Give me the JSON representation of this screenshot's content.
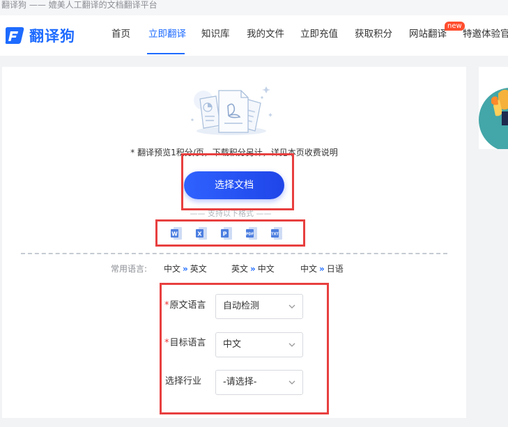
{
  "topbar": {
    "tagline": "翻译狗 —— 媲美人工翻译的文档翻译平台"
  },
  "brand": {
    "name": "翻译狗",
    "accent": "#1e6bff"
  },
  "nav": {
    "items": [
      {
        "label": "首页"
      },
      {
        "label": "立即翻译",
        "active": true
      },
      {
        "label": "知识库"
      },
      {
        "label": "我的文件"
      },
      {
        "label": "立即充值"
      },
      {
        "label": "获取积分"
      },
      {
        "label": "网站翻译"
      },
      {
        "label": "特邀体验官"
      }
    ],
    "badge": "new"
  },
  "upload": {
    "fee_note": "* 翻译预览1积分/页，下载积分另计，详见本页收费说明",
    "select_button": "选择文档",
    "formats_note": "—— 支持以下格式 ——",
    "formats": [
      "word-icon",
      "excel-icon",
      "ppt-icon",
      "pdf-icon",
      "txt-icon"
    ]
  },
  "common_languages": {
    "label": "常用语言:",
    "pairs": [
      {
        "from": "中文",
        "to": "英文"
      },
      {
        "from": "英文",
        "to": "中文"
      },
      {
        "from": "中文",
        "to": "日语"
      }
    ],
    "arrow": "»"
  },
  "form": {
    "source_label": "原文语言",
    "source_value": "自动检测",
    "target_label": "目标语言",
    "target_value": "中文",
    "industry_label": "选择行业",
    "industry_value": "-请选择-",
    "required_mark": "*"
  }
}
